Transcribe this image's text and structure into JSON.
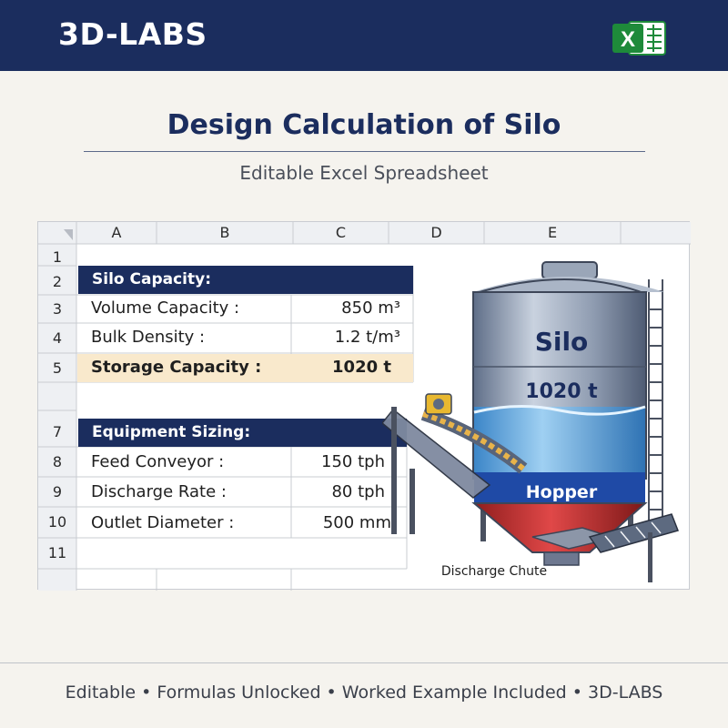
{
  "brand": "3D-LABS",
  "icons": {
    "excel": "excel-icon"
  },
  "colors": {
    "navy": "#1b2d5e",
    "excel_green": "#1e8a3a",
    "highlight": "#f9e9cc"
  },
  "title": "Design Calculation of Silo",
  "subtitle": "Editable Excel Spreadsheet",
  "sheet": {
    "columns": [
      "A",
      "B",
      "C",
      "D",
      "E"
    ],
    "rows": [
      "1",
      "2",
      "3",
      "4",
      "5",
      "7",
      "8",
      "9",
      "10",
      "11"
    ],
    "silo_capacity": {
      "header": "Silo Capacity:",
      "volume_label": "Volume Capacity :",
      "volume_value": "850 m³",
      "density_label": "Bulk Density :",
      "density_value": "1.2 t/m³",
      "storage_label": "Storage Capacity :",
      "storage_value": "1020 t"
    },
    "equipment": {
      "header": "Equipment Sizing:",
      "feed_label": "Feed Conveyor :",
      "feed_value": "150 tph",
      "discharge_label": "Discharge Rate :",
      "discharge_value": "80 tph",
      "outlet_label": "Outlet Diameter :",
      "outlet_value": "500 mm"
    }
  },
  "illustration": {
    "silo_label": "Silo",
    "capacity_label": "1020 t",
    "hopper_label": "Hopper",
    "chute_label": "Discharge Chute"
  },
  "footer": "Editable • Formulas Unlocked • Worked Example Included • 3D-LABS"
}
